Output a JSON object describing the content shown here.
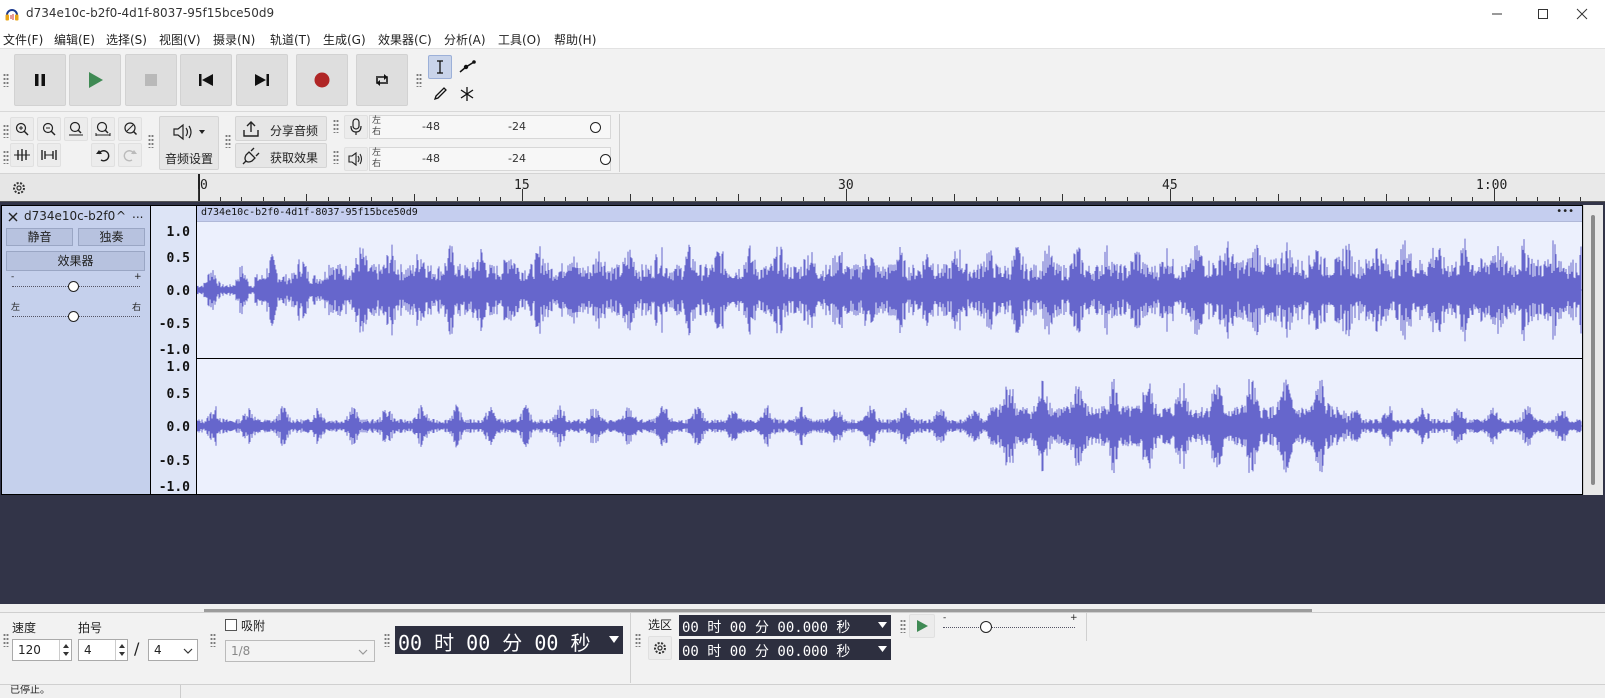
{
  "window": {
    "title": "d734e10c-b2f0-4d1f-8037-95f15bce50d9",
    "minimize_icon": "minimize-icon",
    "maximize_icon": "maximize-icon",
    "close_icon": "close-icon"
  },
  "menu": [
    {
      "label": "文件(F)"
    },
    {
      "label": "编辑(E)"
    },
    {
      "label": "选择(S)"
    },
    {
      "label": "视图(V)"
    },
    {
      "label": "摄录(N)"
    },
    {
      "label": "轨道(T)"
    },
    {
      "label": "生成(G)"
    },
    {
      "label": "效果器(C)"
    },
    {
      "label": "分析(A)"
    },
    {
      "label": "工具(O)"
    },
    {
      "label": "帮助(H)"
    }
  ],
  "transport": {
    "buttons": [
      "pause-icon",
      "play-icon",
      "stop-icon",
      "skip-start-icon",
      "skip-end-icon",
      "record-icon",
      "loop-icon"
    ],
    "colors": {
      "play": "#3f8a54",
      "record": "#b02626"
    }
  },
  "tools": [
    "selection-tool-icon",
    "envelope-tool-icon",
    "draw-tool-icon",
    "multi-tool-icon"
  ],
  "edit_toolbar": {
    "audio_setup_label": "音频设置",
    "share_audio_label": "分享音频",
    "get_effects_label": "获取效果"
  },
  "meters": {
    "record": {
      "left": "左",
      "right": "右",
      "ticks": [
        "-48",
        "-24"
      ]
    },
    "playback": {
      "left": "左",
      "right": "右",
      "ticks": [
        "-48",
        "-24"
      ]
    }
  },
  "ruler": {
    "labels": [
      "0",
      "15",
      "30",
      "45",
      "1:00"
    ]
  },
  "track": {
    "name": "d734e10c-b2f0",
    "menu_caret": "^",
    "more": "...",
    "mute_label": "静音",
    "solo_label": "独奏",
    "effects_label": "效果器",
    "gain_minus": "-",
    "gain_plus": "+",
    "pan_left": "左",
    "pan_right": "右",
    "clip_name": "d734e10c-b2f0-4d1f-8037-95f15bce50d9",
    "clip_more": "•••",
    "channel_scale": [
      "1.0",
      "0.5",
      "0.0",
      "-0.5",
      "-1.0"
    ],
    "wave_color": "#6666cc"
  },
  "bottom": {
    "tempo_label": "速度",
    "tempo_value": "120",
    "meter_label": "拍号",
    "meter_upper": "4",
    "meter_slash": "/",
    "meter_lower": "4",
    "snap_label": "吸附",
    "snap_value": "1/8",
    "time_display": "00 时 00 分 00 秒",
    "selection_label": "选区",
    "sel_start": "00 时 00 分 00.000 秒",
    "sel_end": "00 时 00 分 00.000 秒",
    "speed_minus": "-",
    "speed_plus": "+"
  },
  "status": {
    "text": "已停止。"
  }
}
